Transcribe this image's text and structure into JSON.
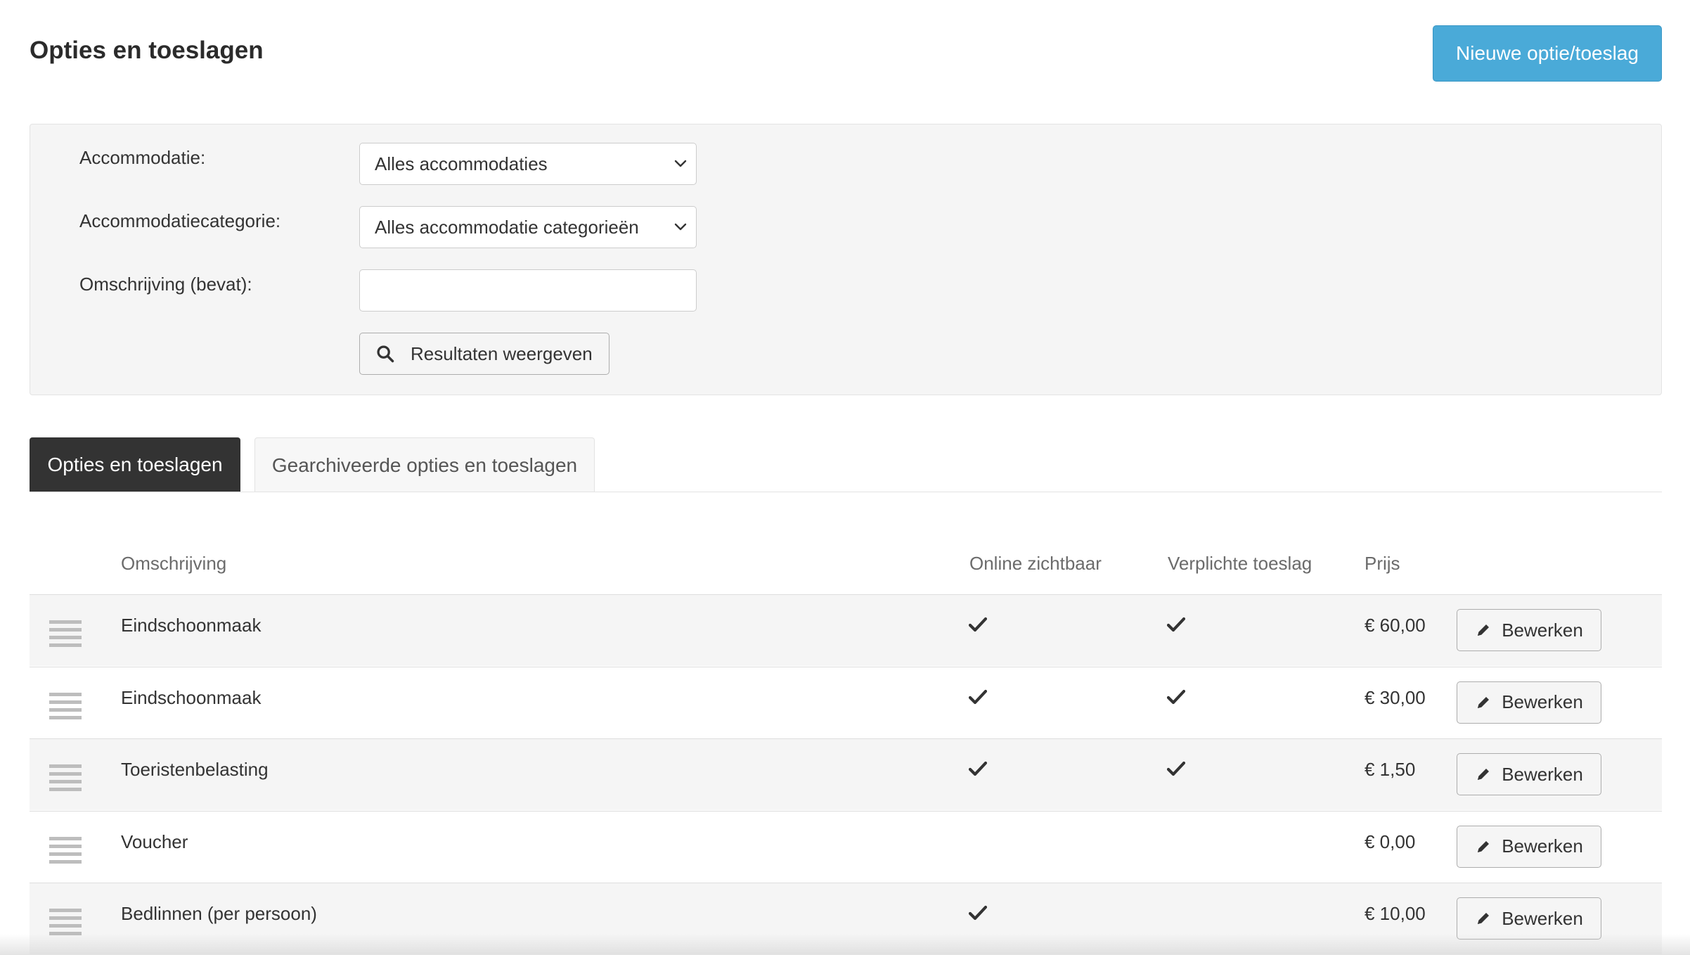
{
  "header": {
    "title": "Opties en toeslagen",
    "new_button_label": "Nieuwe optie/toeslag"
  },
  "filters": {
    "accommodation_label": "Accommodatie:",
    "accommodation_value": "Alles accommodaties",
    "category_label": "Accommodatiecategorie:",
    "category_value": "Alles accommodatie categorieën",
    "description_label": "Omschrijving (bevat):",
    "description_value": "",
    "search_button_label": "Resultaten weergeven"
  },
  "tabs": [
    {
      "label": "Opties en toeslagen",
      "active": true
    },
    {
      "label": "Gearchiveerde opties en toeslagen",
      "active": false
    }
  ],
  "table": {
    "headers": {
      "description": "Omschrijving",
      "online_visible": "Online zichtbaar",
      "mandatory": "Verplichte toeslag",
      "price": "Prijs"
    },
    "edit_label": "Bewerken",
    "rows": [
      {
        "description": "Eindschoonmaak",
        "online_visible": true,
        "mandatory": true,
        "price": "€ 60,00"
      },
      {
        "description": "Eindschoonmaak",
        "online_visible": true,
        "mandatory": true,
        "price": "€ 30,00"
      },
      {
        "description": "Toeristenbelasting",
        "online_visible": true,
        "mandatory": true,
        "price": "€ 1,50"
      },
      {
        "description": "Voucher",
        "online_visible": false,
        "mandatory": false,
        "price": "€ 0,00"
      },
      {
        "description": "Bedlinnen (per persoon)",
        "online_visible": true,
        "mandatory": false,
        "price": "€ 10,00"
      }
    ]
  },
  "icons": {
    "chevron": "chevron-down-icon",
    "search": "search-icon",
    "drag": "drag-handle-icon",
    "check": "check-icon",
    "edit": "pencil-icon"
  },
  "colors": {
    "primary_button": "#4aaad8",
    "active_tab": "#333333",
    "row_striped": "#f5f5f5"
  }
}
